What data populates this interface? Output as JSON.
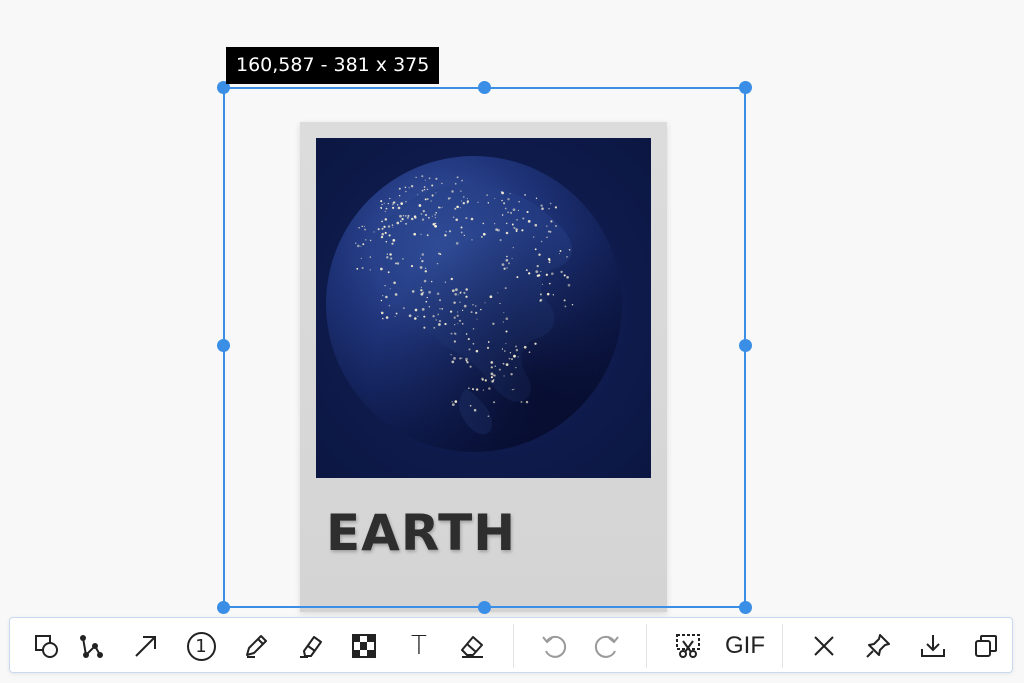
{
  "capture": {
    "size_label": "160,587 - 381 x 375"
  },
  "card": {
    "title": "EARTH",
    "image": "earth-at-night-photo"
  },
  "colors": {
    "selection_accent": "#3a8ee6",
    "tag_background": "#000000",
    "card_background": "#d8d8d8",
    "photo_background": "#0e1b48"
  },
  "toolbar": {
    "tools": [
      {
        "id": "shape",
        "icon": "shape-icon",
        "label": ""
      },
      {
        "id": "polyline",
        "icon": "polyline-icon",
        "label": ""
      },
      {
        "id": "arrow",
        "icon": "arrow-icon",
        "label": ""
      },
      {
        "id": "number",
        "icon": "number-marker-icon",
        "label": "1"
      },
      {
        "id": "pencil",
        "icon": "pencil-icon",
        "label": ""
      },
      {
        "id": "highlighter",
        "icon": "highlighter-icon",
        "label": ""
      },
      {
        "id": "mosaic",
        "icon": "mosaic-icon",
        "label": ""
      },
      {
        "id": "text",
        "icon": "text-icon",
        "label": "T"
      },
      {
        "id": "eraser",
        "icon": "eraser-icon",
        "label": ""
      }
    ],
    "history": [
      {
        "id": "undo",
        "icon": "undo-icon",
        "enabled": false
      },
      {
        "id": "redo",
        "icon": "redo-icon",
        "enabled": false
      }
    ],
    "capture_tools": [
      {
        "id": "scroll-capture",
        "icon": "scissors-icon"
      },
      {
        "id": "gif",
        "icon": "gif-icon",
        "label": "GIF"
      }
    ],
    "actions": [
      {
        "id": "close",
        "icon": "close-icon"
      },
      {
        "id": "pin",
        "icon": "pin-icon"
      },
      {
        "id": "save",
        "icon": "download-icon"
      },
      {
        "id": "copy",
        "icon": "copy-icon"
      }
    ]
  }
}
